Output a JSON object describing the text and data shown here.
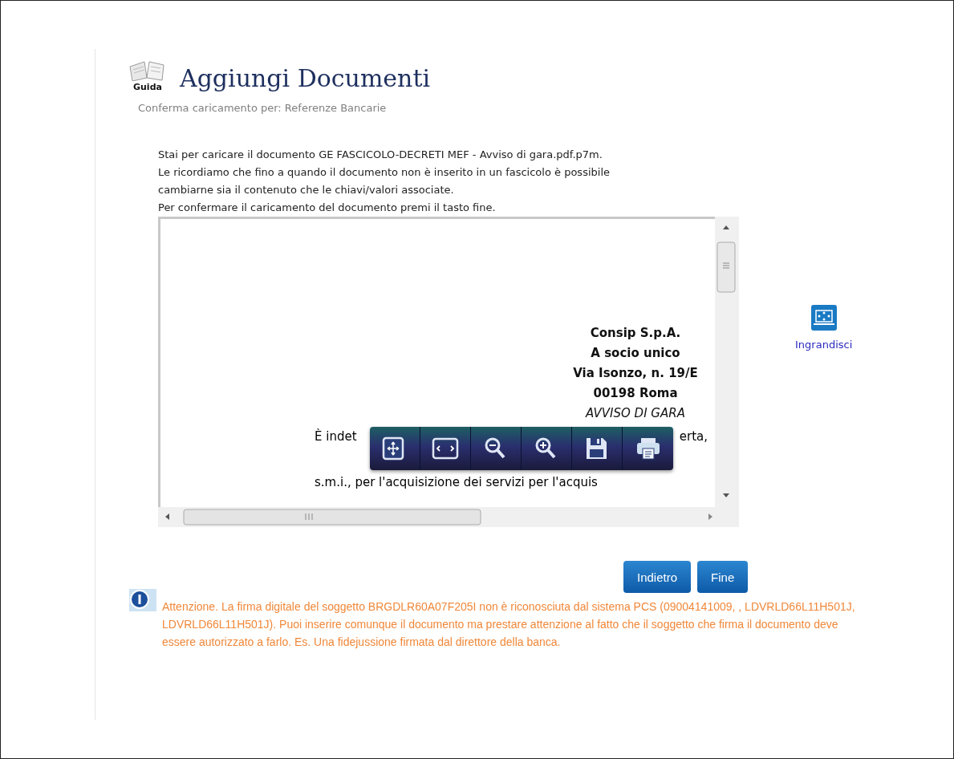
{
  "header": {
    "guide_label": "Guida",
    "title": "Aggiungi Documenti",
    "subtitle": "Conferma caricamento per: Referenze Bancarie"
  },
  "intro": [
    "Stai per caricare il documento GE FASCICOLO-DECRETI MEF - Avviso di gara.pdf.p7m.",
    "Le ricordiamo che fino a quando il documento non è inserito in un fascicolo è possibile",
    "cambiarne sia il contenuto che le chiavi/valori associate.",
    "Per confermare il caricamento del documento premi il tasto fine."
  ],
  "viewer": {
    "address_lines": [
      "Consip S.p.A.",
      "A socio unico",
      "Via Isonzo, n. 19/E",
      "00198 Roma"
    ],
    "heading": "AVVISO DI GARA",
    "body_left": "È indet",
    "body_right": "erta,",
    "body_line": "s.m.i., per l'acquisizione dei servizi per l'acquis",
    "toolbar": [
      {
        "kind": "fit"
      },
      {
        "kind": "width"
      },
      {
        "kind": "zoom_out"
      },
      {
        "kind": "zoom_in"
      },
      {
        "kind": "save"
      },
      {
        "kind": "print"
      }
    ]
  },
  "enlarge": {
    "label": "Ingrandisci"
  },
  "buttons": [
    "Indietro",
    "Fine"
  ],
  "warning": "Attenzione. La firma digitale del soggetto BRGDLR60A07F205I non è riconosciuta dal sistema PCS (09004141009, , LDVRLD66L11H501J, LDVRLD66L11H501J). Puoi inserire comunque il documento ma prestare attenzione al fatto che il soggetto che firma il documento deve essere autorizzato a farlo. Es. Una fidejussione firmata dal direttore della banca."
}
